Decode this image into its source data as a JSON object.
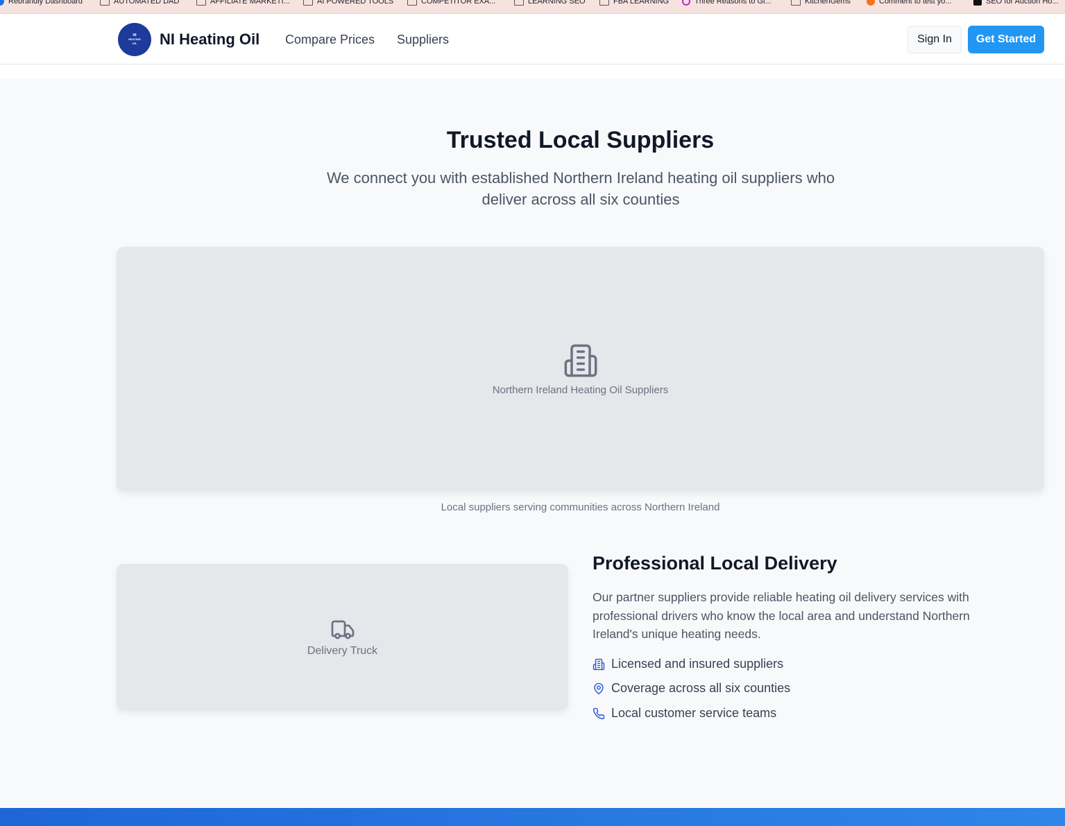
{
  "bookmarks": [
    {
      "label": "Rebrandly Dashboard",
      "icon": "rebrandly-icon"
    },
    {
      "label": "AUTOMATED DAD",
      "icon": "folder-icon"
    },
    {
      "label": "AFFILIATE MARKETI...",
      "icon": "folder-icon"
    },
    {
      "label": "AI POWERED TOOLS",
      "icon": "folder-icon"
    },
    {
      "label": "COMPETITOR EXA...",
      "icon": "folder-icon"
    },
    {
      "label": "LEARNING SEO",
      "icon": "folder-icon"
    },
    {
      "label": "FBA LEARNING",
      "icon": "folder-icon"
    },
    {
      "label": "Three Reasons to Gi...",
      "icon": "site-icon"
    },
    {
      "label": "KitchenGems",
      "icon": "folder-icon"
    },
    {
      "label": "Comment to test yo...",
      "icon": "site-icon"
    },
    {
      "label": "SEO for Auction Ho...",
      "icon": "site-icon"
    }
  ],
  "header": {
    "logo_text": [
      "NI",
      "HEATING",
      "OIL"
    ],
    "brand": "NI Heating Oil",
    "nav": [
      "Compare Prices",
      "Suppliers"
    ],
    "signin": "Sign In",
    "get_started": "Get Started"
  },
  "suppliers": {
    "title": "Trusted Local Suppliers",
    "subtitle": "We connect you with established Northern Ireland heating oil suppliers who deliver across all six counties",
    "image_label": "Northern Ireland Heating Oil Suppliers",
    "image_icon": "building-icon",
    "caption": "Local suppliers serving communities across Northern Ireland"
  },
  "delivery": {
    "image_label": "Delivery Truck",
    "image_icon": "truck-icon",
    "title": "Professional Local Delivery",
    "body": "Our partner suppliers provide reliable heating oil delivery services with professional drivers who know the local area and understand Northern Ireland's unique heating needs.",
    "features": [
      {
        "icon": "building-icon",
        "label": "Licensed and insured suppliers"
      },
      {
        "icon": "map-pin-icon",
        "label": "Coverage across all six counties"
      },
      {
        "icon": "phone-icon",
        "label": "Local customer service teams"
      }
    ]
  },
  "colors": {
    "primary": "#2196f3",
    "logo": "#1e3a9b",
    "accent_icon": "#1d4ed8"
  }
}
